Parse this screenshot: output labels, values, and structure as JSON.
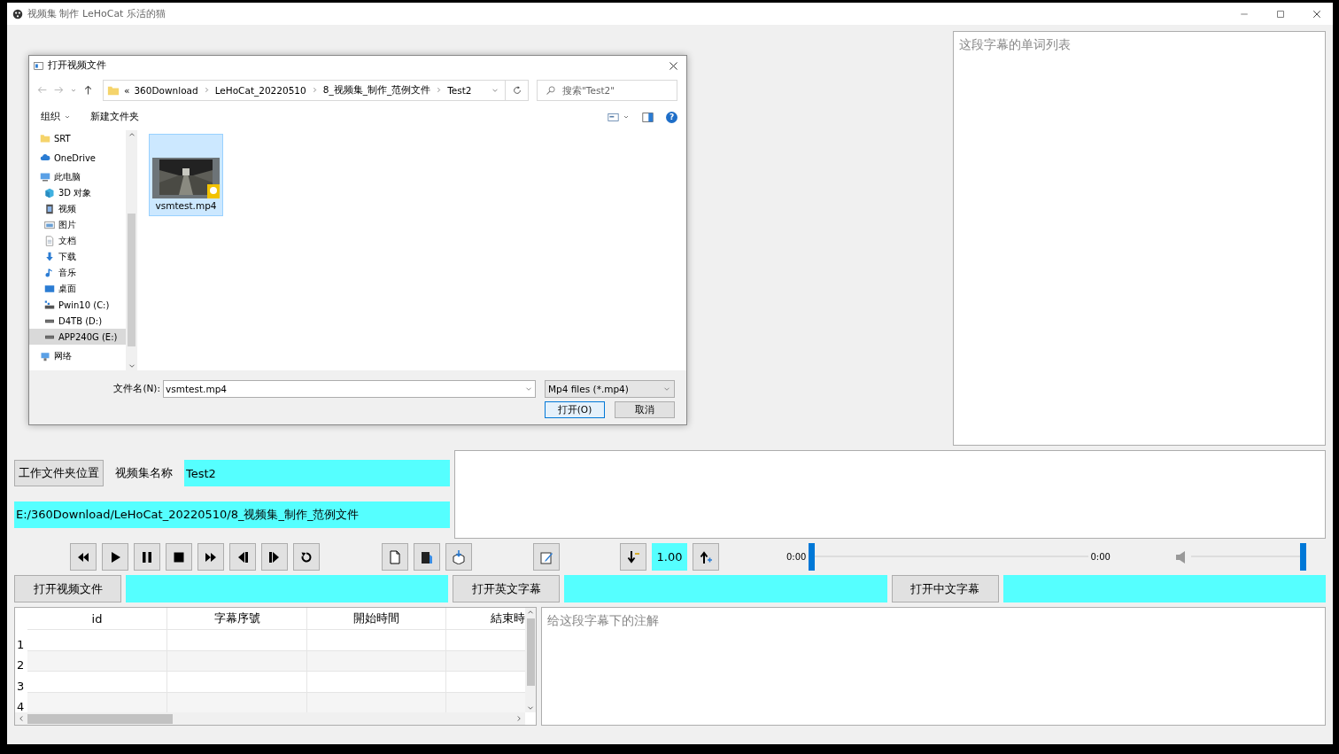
{
  "window": {
    "title": "视频集 制作  LeHoCat 乐活的猫"
  },
  "dialog": {
    "title": "打开视频文件",
    "address": {
      "overflow": "«",
      "path": [
        "360Download",
        "LeHoCat_20220510",
        "8_视频集_制作_范例文件",
        "Test2"
      ]
    },
    "search": {
      "placeholder": "搜索\"Test2\""
    },
    "toolbar": {
      "organize": "组织",
      "new_folder": "新建文件夹",
      "help": "?"
    },
    "nav": [
      {
        "label": "SRT",
        "kind": "folder",
        "selected": false
      },
      {
        "label": "OneDrive",
        "kind": "cloud",
        "selected": false
      },
      {
        "label": "此电脑",
        "kind": "computer",
        "selected": false,
        "children": [
          {
            "label": "3D 对象",
            "kind": "cube",
            "selected": false
          },
          {
            "label": "视频",
            "kind": "video",
            "selected": false
          },
          {
            "label": "图片",
            "selected": false
          },
          {
            "label": "文档",
            "kind": "document",
            "selected": false
          },
          {
            "label": "下载",
            "kind": "download",
            "selected": false
          },
          {
            "label": "音乐",
            "kind": "music",
            "selected": false
          },
          {
            "label": "桌面",
            "kind": "desktop",
            "selected": false
          },
          {
            "label": "Pwin10 (C:)",
            "kind": "system-drive",
            "selected": false
          },
          {
            "label": "D4TB (D:)",
            "kind": "drive",
            "selected": false
          },
          {
            "label": "APP240G (E:)",
            "kind": "drive",
            "selected": true
          }
        ]
      },
      {
        "label": "网络",
        "kind": "network",
        "selected": false
      }
    ],
    "files": [
      {
        "name": "vsmtest.mp4",
        "kind": "picture",
        "selected": true
      }
    ],
    "filename": {
      "label": "文件名(N):",
      "value": "vsmtest.mp4"
    },
    "filter": {
      "value": "Mp4 files (*.mp4)"
    },
    "buttons": [
      {
        "label": "打开(O)",
        "default": true
      },
      {
        "label": "取消",
        "default": false
      }
    ]
  },
  "word_list": {
    "placeholder": "这段字幕的单词列表"
  },
  "project": {
    "folder_button": "工作文件夹位置",
    "name_label": "视频集名称",
    "name_value": "Test2",
    "path_value": "E:/360Download/LeHoCat_20220510/8_视频集_制作_范例文件"
  },
  "player": {
    "media_buttons": [
      {
        "kind": "rewind"
      },
      {
        "kind": "play"
      },
      {
        "kind": "pause"
      },
      {
        "kind": "stop"
      },
      {
        "kind": "forward"
      },
      {
        "kind": "step-back"
      },
      {
        "kind": "step-forward"
      },
      {
        "kind": "replay"
      }
    ],
    "file_buttons": [
      {
        "kind": "new-page"
      },
      {
        "kind": "book"
      },
      {
        "kind": "package"
      }
    ],
    "edit_buttons": [
      {
        "kind": "edit"
      }
    ],
    "speed": {
      "value": "1.00"
    },
    "position": {
      "start": "0:00",
      "end": "0:00",
      "level": 0
    },
    "volume": {
      "level": 1
    }
  },
  "open_rows": [
    {
      "label": "打开视频文件"
    },
    {
      "label": "打开英文字幕"
    },
    {
      "label": "打开中文字幕"
    }
  ],
  "table": {
    "columns": [
      "id",
      "字幕序號",
      "開始時間",
      "結束時"
    ],
    "rows": [
      {
        "number": "1"
      },
      {
        "number": "2"
      },
      {
        "number": "3"
      },
      {
        "number": "4"
      }
    ]
  },
  "annotation": {
    "placeholder": "给这段字幕下的注解"
  }
}
